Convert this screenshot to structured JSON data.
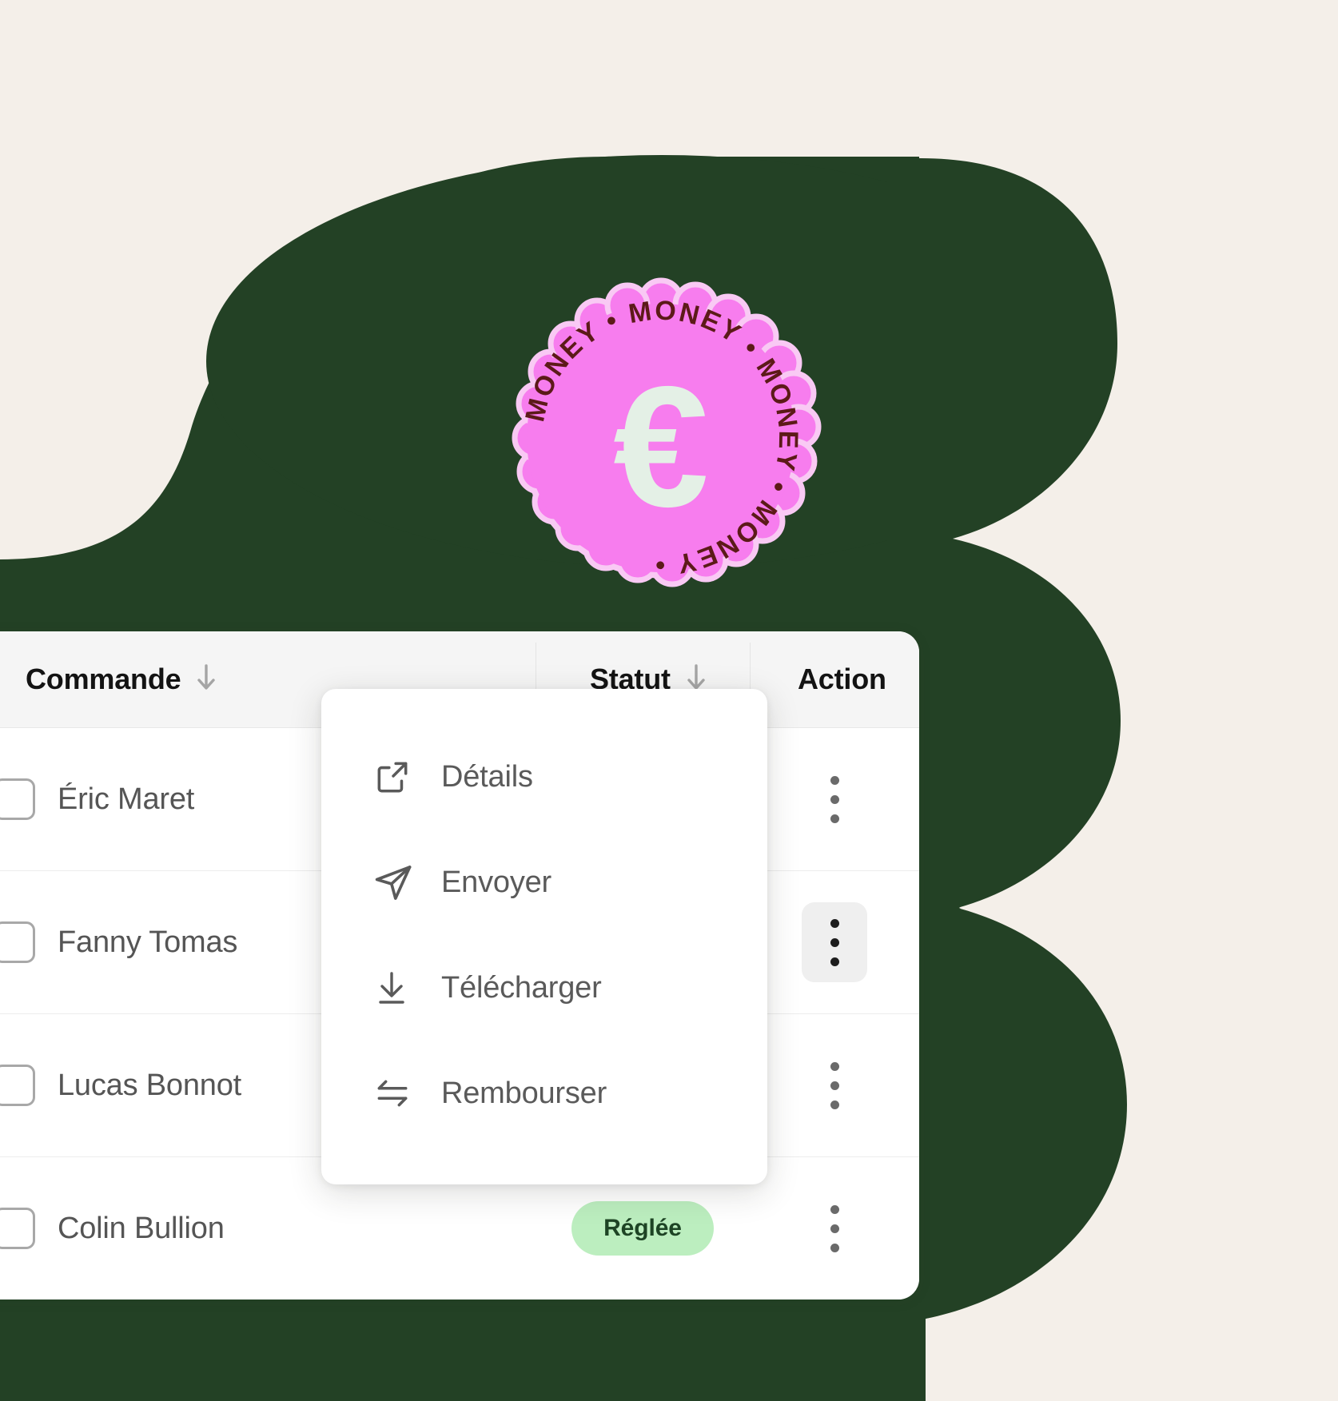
{
  "palette": {
    "page_background": "#F4EFE9",
    "blob_green": "#234125",
    "stamp_pink": "#F77DEE",
    "stamp_text_maroon": "#5C1A18",
    "euro_glyph": "#E4F0E6",
    "badge_bg": "#BCEEBF",
    "badge_text": "#1E4425"
  },
  "stamp": {
    "ring_text": "MONEY",
    "ring_separator": "•",
    "ring_repeats": 4,
    "center_symbol": "€",
    "name": "money-stamp"
  },
  "table": {
    "headers": [
      {
        "label": "Commande",
        "sort_icon": "arrow-down-icon",
        "has_select_all_checkbox": true
      },
      {
        "label": "Statut",
        "sort_icon": "arrow-down-icon",
        "has_select_all_checkbox": false
      },
      {
        "label": "Action",
        "sort_icon": null,
        "has_select_all_checkbox": false
      }
    ],
    "rows": [
      {
        "name": "Éric Maret",
        "checked": false,
        "status": "",
        "action_icon": "kebab-menu-icon",
        "action_active": false
      },
      {
        "name": "Fanny Tomas",
        "checked": false,
        "status": "",
        "action_icon": "kebab-menu-icon",
        "action_active": true
      },
      {
        "name": "Lucas Bonnot",
        "checked": false,
        "status": "",
        "action_icon": "kebab-menu-icon",
        "action_active": false
      },
      {
        "name": "Colin Bullion",
        "checked": false,
        "status": "Réglée",
        "action_icon": "kebab-menu-icon",
        "action_active": false
      }
    ]
  },
  "context_menu": {
    "items": [
      {
        "label": "Détails",
        "icon": "external-link-icon"
      },
      {
        "label": "Envoyer",
        "icon": "send-icon"
      },
      {
        "label": "Télécharger",
        "icon": "download-icon"
      },
      {
        "label": "Rembourser",
        "icon": "swap-arrows-icon"
      }
    ]
  }
}
